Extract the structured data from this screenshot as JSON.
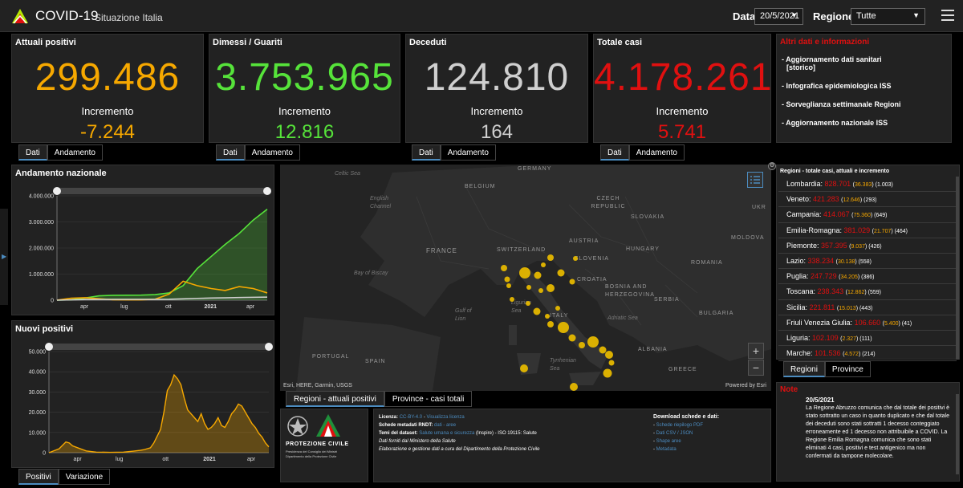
{
  "header": {
    "app_title": "COVID-19",
    "app_subtitle": "Situazione Italia",
    "date_label": "Data",
    "date_value": "20/5/2021",
    "region_label": "Regione",
    "region_value": "Tutte"
  },
  "kpis": [
    {
      "title": "Attuali positivi",
      "value": "299.486",
      "inc_label": "Incremento",
      "inc": "-7.244",
      "color": "#f6a800"
    },
    {
      "title": "Dimessi / Guariti",
      "value": "3.753.965",
      "inc_label": "Incremento",
      "inc": "12.816",
      "color": "#56e33a"
    },
    {
      "title": "Deceduti",
      "value": "124.810",
      "inc_label": "Incremento",
      "inc": "164",
      "color": "#cfcfcf"
    },
    {
      "title": "Totale casi",
      "value": "4.178.261",
      "inc_label": "Incremento",
      "inc": "5.741",
      "color": "#e01010"
    }
  ],
  "kpi_tabs": {
    "dati": "Dati",
    "andamento": "Andamento"
  },
  "info": {
    "title": "Altri dati e informazioni",
    "items": [
      "- Aggiornamento dati sanitari",
      "[storico]",
      "- Infografica epidemiologica ISS",
      "- Sorveglianza settimanale Regioni",
      "- Aggiornamento nazionale ISS"
    ]
  },
  "andamento": {
    "title": "Andamento nazionale",
    "chart_data": {
      "type": "line",
      "x": [
        "2020-02",
        "2020-03",
        "2020-04",
        "2020-05",
        "2020-06",
        "2020-07",
        "2020-08",
        "2020-09",
        "2020-10",
        "2020-11",
        "2020-12",
        "2021-01",
        "2021-02",
        "2021-03",
        "2021-04",
        "2021-05"
      ],
      "xticks": [
        "apr",
        "lug",
        "ott",
        "2021",
        "apr"
      ],
      "yticks": [
        "0",
        "1.000.000",
        "2.000.000",
        "3.000.000",
        "4.000.000"
      ],
      "ylim": [
        0,
        4300000
      ],
      "series": [
        {
          "color": "#56e33a",
          "values": [
            0,
            15000,
            90000,
            180000,
            200000,
            205000,
            210000,
            230000,
            300000,
            600000,
            1300000,
            1800000,
            2300000,
            2750000,
            3300000,
            3750000
          ]
        },
        {
          "color": "#f6a800",
          "values": [
            3000,
            80000,
            100000,
            60000,
            20000,
            12000,
            16000,
            40000,
            250000,
            780000,
            600000,
            480000,
            400000,
            560000,
            480000,
            300000
          ]
        },
        {
          "color": "#cfcfcf",
          "values": [
            0,
            12000,
            28000,
            33000,
            34000,
            35000,
            35500,
            36000,
            39000,
            55000,
            74000,
            89000,
            97000,
            109000,
            119000,
            124800
          ]
        }
      ]
    }
  },
  "nuovi": {
    "title": "Nuovi positivi",
    "chart_data": {
      "type": "area",
      "xticks": [
        "apr",
        "lug",
        "ott",
        "2021",
        "apr"
      ],
      "yticks": [
        "0",
        "10.000",
        "20.000",
        "30.000",
        "40.000",
        "50.000"
      ],
      "ylim": [
        0,
        52000
      ],
      "color": "#f6a800",
      "points": [
        [
          0,
          0
        ],
        [
          3,
          2000
        ],
        [
          5,
          5500
        ],
        [
          6,
          5000
        ],
        [
          7,
          3500
        ],
        [
          9,
          2200
        ],
        [
          11,
          900
        ],
        [
          14,
          300
        ],
        [
          18,
          200
        ],
        [
          22,
          300
        ],
        [
          25,
          800
        ],
        [
          27,
          1200
        ],
        [
          28,
          1500
        ],
        [
          30,
          2500
        ],
        [
          31,
          5000
        ],
        [
          33,
          12000
        ],
        [
          34,
          21000
        ],
        [
          35,
          32000
        ],
        [
          36,
          35000
        ],
        [
          37,
          40000
        ],
        [
          38,
          38000
        ],
        [
          39,
          35000
        ],
        [
          40,
          28000
        ],
        [
          41,
          22000
        ],
        [
          42,
          20000
        ],
        [
          43,
          18000
        ],
        [
          44,
          16000
        ],
        [
          45,
          20000
        ],
        [
          46,
          15000
        ],
        [
          47,
          12000
        ],
        [
          48,
          13000
        ],
        [
          49,
          15000
        ],
        [
          50,
          18000
        ],
        [
          51,
          14000
        ],
        [
          52,
          13000
        ],
        [
          53,
          16000
        ],
        [
          54,
          20000
        ],
        [
          55,
          22000
        ],
        [
          56,
          25000
        ],
        [
          57,
          24000
        ],
        [
          58,
          21000
        ],
        [
          59,
          18000
        ],
        [
          60,
          15000
        ],
        [
          61,
          13000
        ],
        [
          62,
          10000
        ],
        [
          63,
          8000
        ],
        [
          64,
          5000
        ],
        [
          65,
          3000
        ]
      ]
    }
  },
  "chart_tabs": {
    "positivi": "Positivi",
    "variazione": "Variazione"
  },
  "map": {
    "labels": [
      {
        "t": "Celtic Sea",
        "sea": true
      },
      {
        "t": "GERMANY"
      },
      {
        "t": "BELGIUM"
      },
      {
        "t": "English Channel",
        "sea": true
      },
      {
        "t": "CZECH REPUBLIC"
      },
      {
        "t": "SLOVAKIA"
      },
      {
        "t": "UKR"
      },
      {
        "t": "FRANCE"
      },
      {
        "t": "SWITZERLAND"
      },
      {
        "t": "AUSTRIA"
      },
      {
        "t": "HUNGARY"
      },
      {
        "t": "MOLDOVA"
      },
      {
        "t": "Bay of Biscay",
        "sea": true
      },
      {
        "t": "SLOVENIA"
      },
      {
        "t": "ROMANIA"
      },
      {
        "t": "CROATIA"
      },
      {
        "t": "BOSNIA AND HERZEGOVINA"
      },
      {
        "t": "SERBIA"
      },
      {
        "t": "Ligurian Sea",
        "sea": true
      },
      {
        "t": "Gulf of Lion",
        "sea": true
      },
      {
        "t": "ITALY"
      },
      {
        "t": "Adriatic Sea",
        "sea": true
      },
      {
        "t": "BULGARIA"
      },
      {
        "t": "PORTUGAL"
      },
      {
        "t": "SPAIN"
      },
      {
        "t": "Tyrrhenian Sea",
        "sea": true
      },
      {
        "t": "ALBANIA"
      },
      {
        "t": "GREECE"
      }
    ],
    "attribution": "Esri, HERE, Garmin, USGS",
    "powered": "Powered by Esri",
    "zoom_in": "+",
    "zoom_out": "−"
  },
  "map_tabs": {
    "regioni": "Regioni - attuali positivi",
    "province": "Province - casi totali"
  },
  "regions": {
    "title": "Regioni - totale casi, attuali e incremento",
    "rows": [
      {
        "name": "Lombardia:",
        "total": "828.701",
        "att": "36.383",
        "inc": "1.003"
      },
      {
        "name": "Veneto:",
        "total": "421.283",
        "att": "12.646",
        "inc": "293"
      },
      {
        "name": "Campania:",
        "total": "414.067",
        "att": "75.360",
        "inc": "649"
      },
      {
        "name": "Emilia-Romagna:",
        "total": "381.029",
        "att": "21.707",
        "inc": "464"
      },
      {
        "name": "Piemonte:",
        "total": "357.395",
        "att": "9.037",
        "inc": "426"
      },
      {
        "name": "Lazio:",
        "total": "338.234",
        "att": "30.138",
        "inc": "558"
      },
      {
        "name": "Puglia:",
        "total": "247.729",
        "att": "34.205",
        "inc": "386"
      },
      {
        "name": "Toscana:",
        "total": "238.343",
        "att": "12.862",
        "inc": "559"
      },
      {
        "name": "Sicilia:",
        "total": "221.811",
        "att": "15.013",
        "inc": "443"
      },
      {
        "name": "Friuli Venezia Giulia:",
        "total": "106.660",
        "att": "5.400",
        "inc": "41"
      },
      {
        "name": "Liguria:",
        "total": "102.109",
        "att": "2.327",
        "inc": "111"
      },
      {
        "name": "Marche:",
        "total": "101.536",
        "att": "4.572",
        "inc": "214"
      }
    ]
  },
  "region_tabs": {
    "regioni": "Regioni",
    "province": "Province"
  },
  "note": {
    "title": "Note",
    "date": "20/5/2021",
    "text": "La Regione Abruzzo comunica che dal totale dei positivi è stato sottratto un caso in quanto duplicato e che dal totale dei deceduti sono stati sottratti 1 decesso conteggiato erroneamente ed 1 decesso non attribuibile a COVID. La Regione Emilia Romagna comunica che sono stati eliminati 4 casi, positivi e test antigenico ma non confermati da tampone molecolare."
  },
  "footer": {
    "logo_text": "PROTEZIONE CIVILE",
    "logo_sub1": "Presidenza del Consiglio dei Ministri",
    "logo_sub2": "Dipartimento della Protezione Civile",
    "licenza_label": "Licenza:",
    "licenza_link": "CC-BY-4.0",
    "licenza_view": "Visualizza licenza",
    "schede_label": "Schede metadati RNDT:",
    "schede_link": "dati - aree",
    "temi_label": "Temi del dataset:",
    "temi_link": "Salute umana e sicurezza",
    "temi_rest": "(Inspire) - ISO 19115: Salute",
    "fonte": "Dati forniti dal Ministero della Salute",
    "elab": "Elaborazione e gestione dati a cura del Dipartimento della Protezione Civile",
    "download_title": "Download schede e dati:",
    "downloads": [
      "Schede riepilogo PDF",
      "Dati CSV / JSON",
      "Shape aree",
      "Metadata"
    ]
  },
  "colors": {
    "accent": "#4c8cc0",
    "panel": "#222222",
    "orange": "#f6a800",
    "green": "#56e33a",
    "red": "#e01010",
    "grey": "#cfcfcf"
  },
  "icons": {
    "menu": "menu-icon",
    "list": "list-icon",
    "logo": "covid-logo-icon"
  }
}
